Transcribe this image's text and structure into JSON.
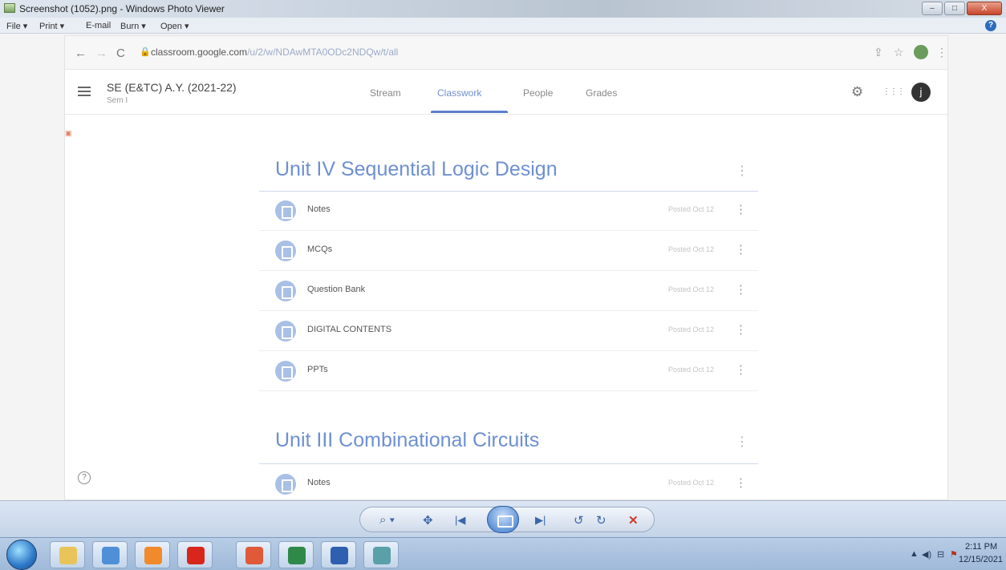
{
  "window": {
    "title": "Screenshot (1052).png - Windows Photo Viewer",
    "minimize": "–",
    "maximize": "□",
    "close": "X"
  },
  "menu": {
    "file": "File ▾",
    "print": "Print ▾",
    "email": "E-mail",
    "burn": "Burn ▾",
    "open": "Open ▾",
    "help": "?"
  },
  "browser": {
    "url_domain": "classroom.google.com",
    "url_path": "/u/2/w/NDAwMTA0ODc2NDQw/t/all",
    "back": "←",
    "forward": "→",
    "reload": "C",
    "share": "⇪",
    "star": "☆",
    "menu": "⋮"
  },
  "classroom": {
    "class_name": "SE (E&TC) A.Y. (2021-22)",
    "class_subtitle": "Sem I",
    "tabs": [
      {
        "label": "Stream"
      },
      {
        "label": "Classwork"
      },
      {
        "label": "People"
      },
      {
        "label": "Grades"
      }
    ],
    "active_tab": "Classwork",
    "avatar_letter": "j",
    "settings": "⚙",
    "apps": "⋮⋮⋮",
    "help": "?"
  },
  "topics": [
    {
      "title": "Unit IV Sequential Logic Design",
      "items": [
        {
          "label": "Notes",
          "posted": "Posted Oct 12"
        },
        {
          "label": "MCQs",
          "posted": "Posted Oct 12"
        },
        {
          "label": "Question Bank",
          "posted": "Posted Oct 12"
        },
        {
          "label": "DIGITAL CONTENTS",
          "posted": "Posted Oct 12"
        },
        {
          "label": "PPTs",
          "posted": "Posted Oct 12"
        }
      ]
    },
    {
      "title": "Unit III Combinational Circuits",
      "items": [
        {
          "label": "Notes",
          "posted": "Posted Oct 12"
        }
      ]
    }
  ],
  "more_glyph": "⋮",
  "viewer_toolbar": {
    "zoom": "⌕ ▾",
    "fit": "✥",
    "prev": "|◀",
    "next": "▶|",
    "rotate_left": "↺",
    "rotate_right": "↻",
    "delete": "✕"
  },
  "taskbar": {
    "tray": [
      "▲",
      "◀)",
      "⊟",
      "⚑"
    ],
    "time": "2:11 PM",
    "date": "12/15/2021",
    "apps": [
      {
        "name": "file-explorer",
        "color": "#e8c45a"
      },
      {
        "name": "internet-explorer",
        "color": "#4f8fd8"
      },
      {
        "name": "media-player",
        "color": "#f08a2a"
      },
      {
        "name": "opera",
        "color": "#d8261c"
      },
      {
        "name": "chrome",
        "color": "#e05a3a"
      },
      {
        "name": "excel",
        "color": "#2f8a4a"
      },
      {
        "name": "word",
        "color": "#2f5fb0"
      },
      {
        "name": "photo-viewer",
        "color": "#5aa0a8"
      }
    ]
  }
}
